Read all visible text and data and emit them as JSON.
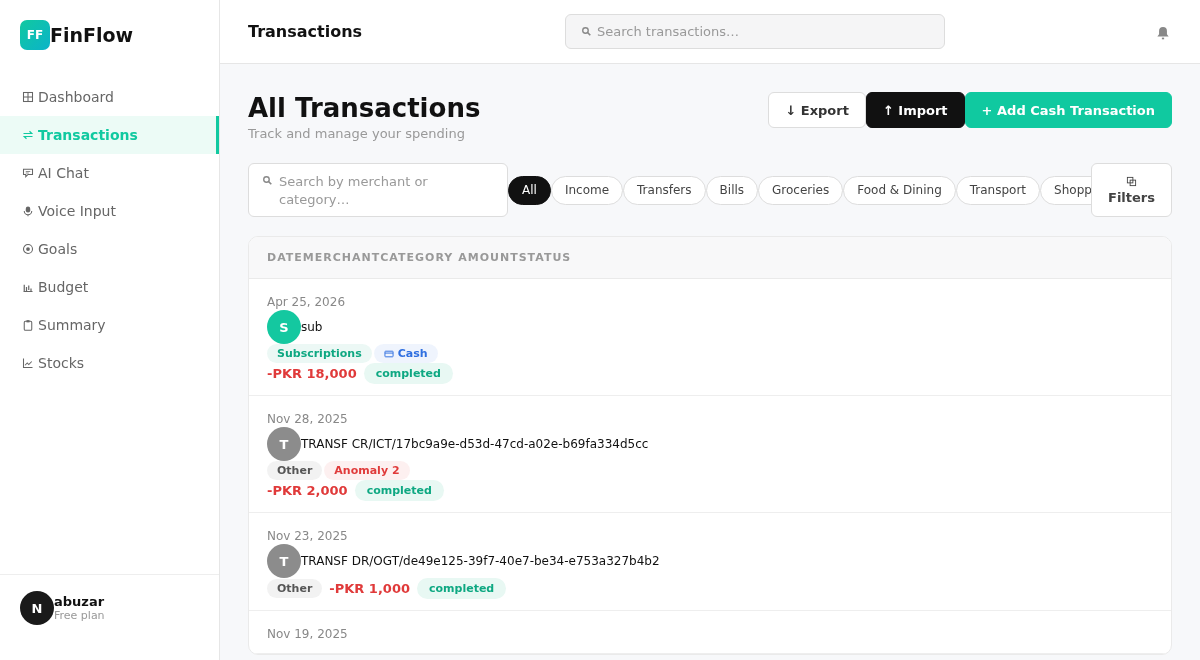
{
  "brand": {
    "logo": "FF",
    "name": "FinFlow"
  },
  "sidebar": {
    "items": [
      {
        "label": "Dashboard",
        "selected": false
      },
      {
        "label": "Transactions",
        "selected": true
      },
      {
        "label": "AI Chat",
        "selected": false
      },
      {
        "label": "Voice Input",
        "selected": false
      },
      {
        "label": "Goals",
        "selected": false
      },
      {
        "label": "Budget",
        "selected": false
      },
      {
        "label": "Summary",
        "selected": false
      },
      {
        "label": "Stocks",
        "selected": false
      }
    ],
    "user": {
      "initial": "N",
      "name": "abuzar",
      "plan": "Free plan"
    }
  },
  "topbar": {
    "title": "Transactions",
    "search": {
      "placeholder": "Search transactions…"
    }
  },
  "page": {
    "title": "All Transactions",
    "subtitle": "Track and manage your spending",
    "buttons": [
      {
        "label": "↓ Export",
        "kind": "outline"
      },
      {
        "label": "↑ Import",
        "kind": "dark"
      },
      {
        "label": "+ Add Cash Transaction",
        "kind": "primary"
      }
    ]
  },
  "filters": {
    "search": {
      "placeholder": "Search by merchant or category…"
    },
    "chips": [
      {
        "label": "All",
        "selected": true
      },
      {
        "label": "Income",
        "selected": false
      },
      {
        "label": "Transfers",
        "selected": false
      },
      {
        "label": "Bills",
        "selected": false
      },
      {
        "label": "Groceries",
        "selected": false
      },
      {
        "label": "Food & Dining",
        "selected": false
      },
      {
        "label": "Transport",
        "selected": false
      },
      {
        "label": "Shopp",
        "selected": false
      }
    ],
    "button": "Filters"
  },
  "table": {
    "columns": [
      "DATE",
      "MERCHANT",
      "CATEGORY",
      "AMOUNT",
      "STATUS"
    ],
    "rows": [
      {
        "date": "Apr 25, 2026",
        "initial": "S",
        "color": "#14c8a0",
        "merchant": "sub",
        "tags": [
          {
            "label": "Subscriptions",
            "kind": "category",
            "color": "#0ea882"
          },
          {
            "label": "Cash",
            "kind": "payment",
            "color": "#2f6fe0"
          }
        ],
        "amount": "-PKR 18,000",
        "status": "completed"
      },
      {
        "date": "Nov 28, 2025",
        "initial": "T",
        "color": "#8c8c8c",
        "merchant": "TRANSF CR/ICT/17bc9a9e-d53d-47cd-a02e-b69fa334d5cc",
        "tags": [
          {
            "label": "Other",
            "kind": "category",
            "color": "#555555"
          },
          {
            "label": "Anomaly 2",
            "kind": "anomaly",
            "color": "#e03a3a"
          }
        ],
        "amount": "-PKR 2,000",
        "status": "completed"
      },
      {
        "date": "Nov 23, 2025",
        "initial": "T",
        "color": "#8c8c8c",
        "merchant": "TRANSF DR/OGT/de49e125-39f7-40e7-be34-e753a327b4b2",
        "tags": [
          {
            "label": "Other",
            "kind": "category",
            "color": "#555555"
          }
        ],
        "amount": "-PKR 1,000",
        "status": "completed"
      },
      {
        "date": "Nov 19, 2025"
      }
    ]
  }
}
